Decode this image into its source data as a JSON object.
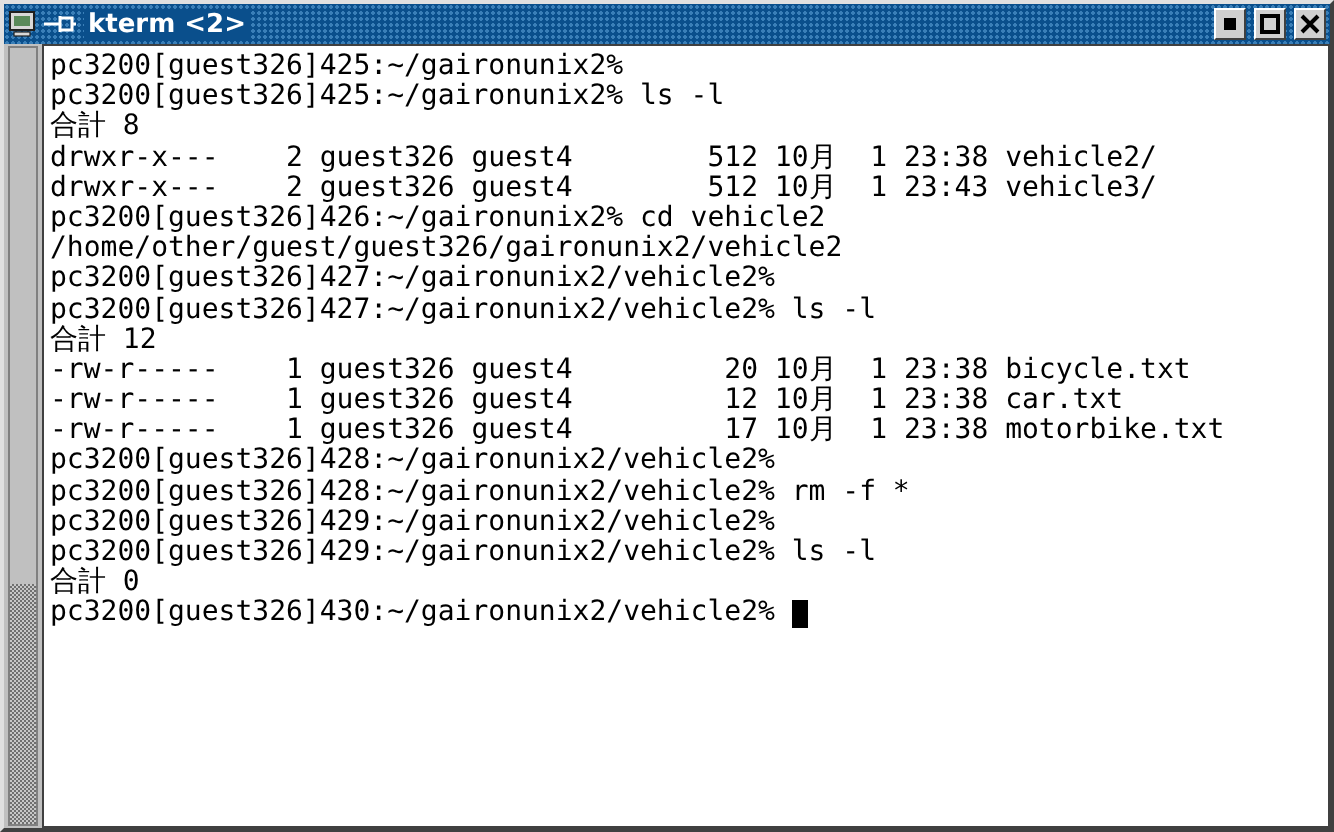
{
  "window": {
    "title": "kterm <2>"
  },
  "terminal": {
    "lines": [
      "pc3200[guest326]425:~/gaironunix2%",
      "pc3200[guest326]425:~/gaironunix2% ls -l",
      "合計 8",
      "drwxr-x---    2 guest326 guest4        512 10月  1 23:38 vehicle2/",
      "drwxr-x---    2 guest326 guest4        512 10月  1 23:43 vehicle3/",
      "pc3200[guest326]426:~/gaironunix2% cd vehicle2",
      "/home/other/guest/guest326/gaironunix2/vehicle2",
      "pc3200[guest326]427:~/gaironunix2/vehicle2%",
      "pc3200[guest326]427:~/gaironunix2/vehicle2% ls -l",
      "合計 12",
      "-rw-r-----    1 guest326 guest4         20 10月  1 23:38 bicycle.txt",
      "-rw-r-----    1 guest326 guest4         12 10月  1 23:38 car.txt",
      "-rw-r-----    1 guest326 guest4         17 10月  1 23:38 motorbike.txt",
      "pc3200[guest326]428:~/gaironunix2/vehicle2%",
      "pc3200[guest326]428:~/gaironunix2/vehicle2% rm -f *",
      "pc3200[guest326]429:~/gaironunix2/vehicle2%",
      "pc3200[guest326]429:~/gaironunix2/vehicle2% ls -l",
      "合計 0",
      "pc3200[guest326]430:~/gaironunix2/vehicle2% "
    ],
    "cursor": true
  }
}
